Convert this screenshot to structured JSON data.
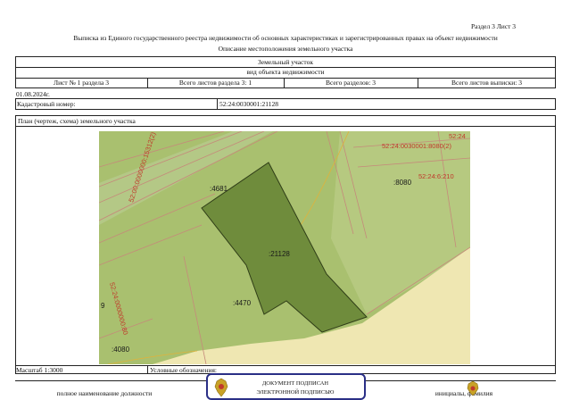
{
  "header": {
    "section_sheet": "Раздел 3    Лист 3",
    "title_line1": "Выписка из Единого государственного реестра недвижимости об основных характеристиках и зарегистрированных правах на объект недвижимости",
    "title_line2": "Описание местоположения земельного участка"
  },
  "object": {
    "type": "Земельный участок",
    "type_caption": "вид объекта недвижимости"
  },
  "sheet_row": {
    "sheet_no": "Лист № 1 раздела 3",
    "total_sheets_section": "Всего листов раздела 3: 1",
    "total_sections": "Всего разделов: 3",
    "total_sheets_extract": "Всего листов выписки: 3"
  },
  "date": "01.08.2024г.",
  "cadastral": {
    "label": "Кадастровый номер:",
    "value": "52:24:0030001:21128"
  },
  "plan_title": "План (чертеж, схема) земельного участка",
  "map_labels": {
    "parcel_main": ":21128",
    "parcel_4681": ":4681",
    "parcel_4470": ":4470",
    "parcel_4080": ":4080",
    "parcel_8080": ":8080",
    "road_label": "52:00:0000000:15312(2)",
    "quarter_label_top": "52:24:0030001:8080(2)",
    "quarter_label_left": "52:24:0000000:80",
    "right_label": "52:24:6:210",
    "corner_label": "52:24",
    "left_edge_char": "9"
  },
  "footer": {
    "scale": "Масштаб 1:3000",
    "legend": "Условные обозначения:",
    "position_label": "полное наименование должности",
    "signature_label": "инициалы, фамилия"
  },
  "stamp": {
    "line1": "ДОКУМЕНТ ПОДПИСАН",
    "line2": "ЭЛЕКТРОННОЙ ПОДПИСЬЮ"
  },
  "colors": {
    "map_green": "#a9c06f",
    "parcel_dark": "#6f8c3c",
    "beige": "#efe7b2",
    "label_red": "#c0392b",
    "stamp_blue": "#2a2f86"
  }
}
